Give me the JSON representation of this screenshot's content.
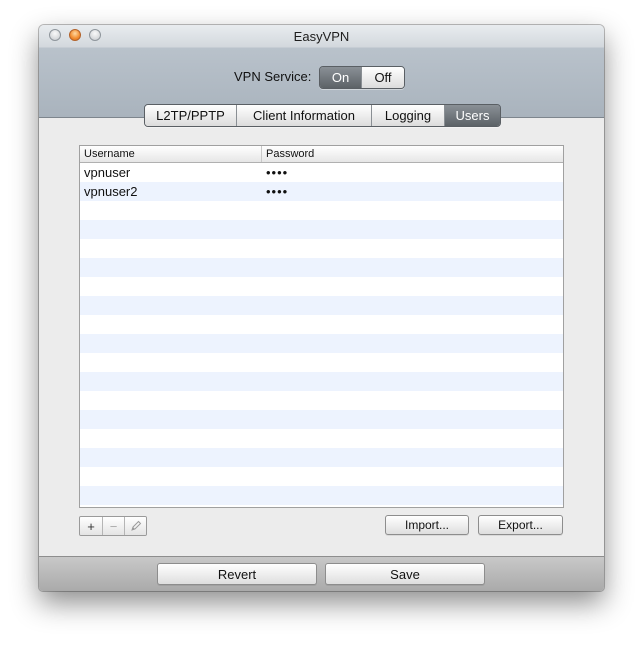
{
  "window": {
    "title": "EasyVPN"
  },
  "vpn_service": {
    "label": "VPN Service:",
    "options": [
      "On",
      "Off"
    ],
    "selected": "On"
  },
  "tabs": [
    {
      "label": "L2TP/PPTP"
    },
    {
      "label": "Client Information"
    },
    {
      "label": "Logging"
    },
    {
      "label": "Users"
    }
  ],
  "selected_tab": "Users",
  "users_table": {
    "columns": [
      "Username",
      "Password"
    ],
    "rows": [
      {
        "username": "vpnuser",
        "password": "••••"
      },
      {
        "username": "vpnuser2",
        "password": "••••"
      }
    ]
  },
  "table_controls": {
    "add_icon": "plus-icon",
    "remove_icon": "minus-icon",
    "edit_icon": "pencil-icon",
    "add_label": "+",
    "remove_label": "−"
  },
  "buttons": {
    "import": "Import...",
    "export": "Export...",
    "revert": "Revert",
    "save": "Save"
  },
  "colors": {
    "selected_segment": "#5c6267",
    "row_stripe": "#edf3fe",
    "minimize_button": "#f28c2f"
  }
}
